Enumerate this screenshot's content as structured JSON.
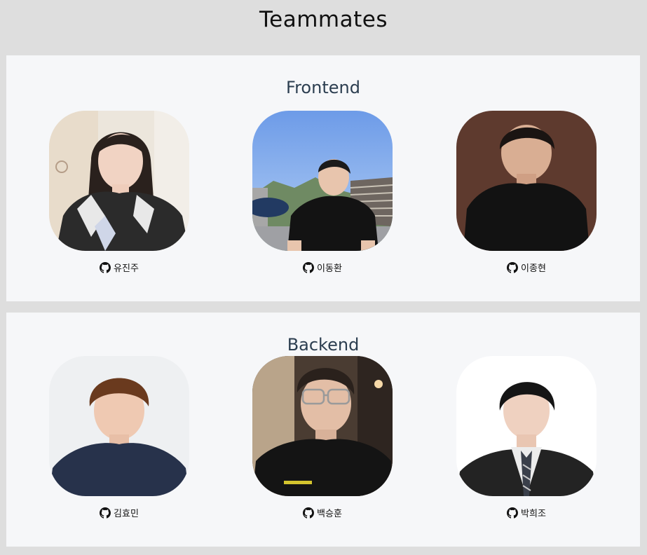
{
  "page": {
    "title": "Teammates"
  },
  "sections": [
    {
      "title": "Frontend",
      "members": [
        {
          "name": "유진주",
          "link_icon": "github-icon"
        },
        {
          "name": "이동환",
          "link_icon": "github-icon"
        },
        {
          "name": "이종현",
          "link_icon": "github-icon"
        }
      ]
    },
    {
      "title": "Backend",
      "members": [
        {
          "name": "김효민",
          "link_icon": "github-icon"
        },
        {
          "name": "백승훈",
          "link_icon": "github-icon"
        },
        {
          "name": "박희조",
          "link_icon": "github-icon"
        }
      ]
    }
  ]
}
